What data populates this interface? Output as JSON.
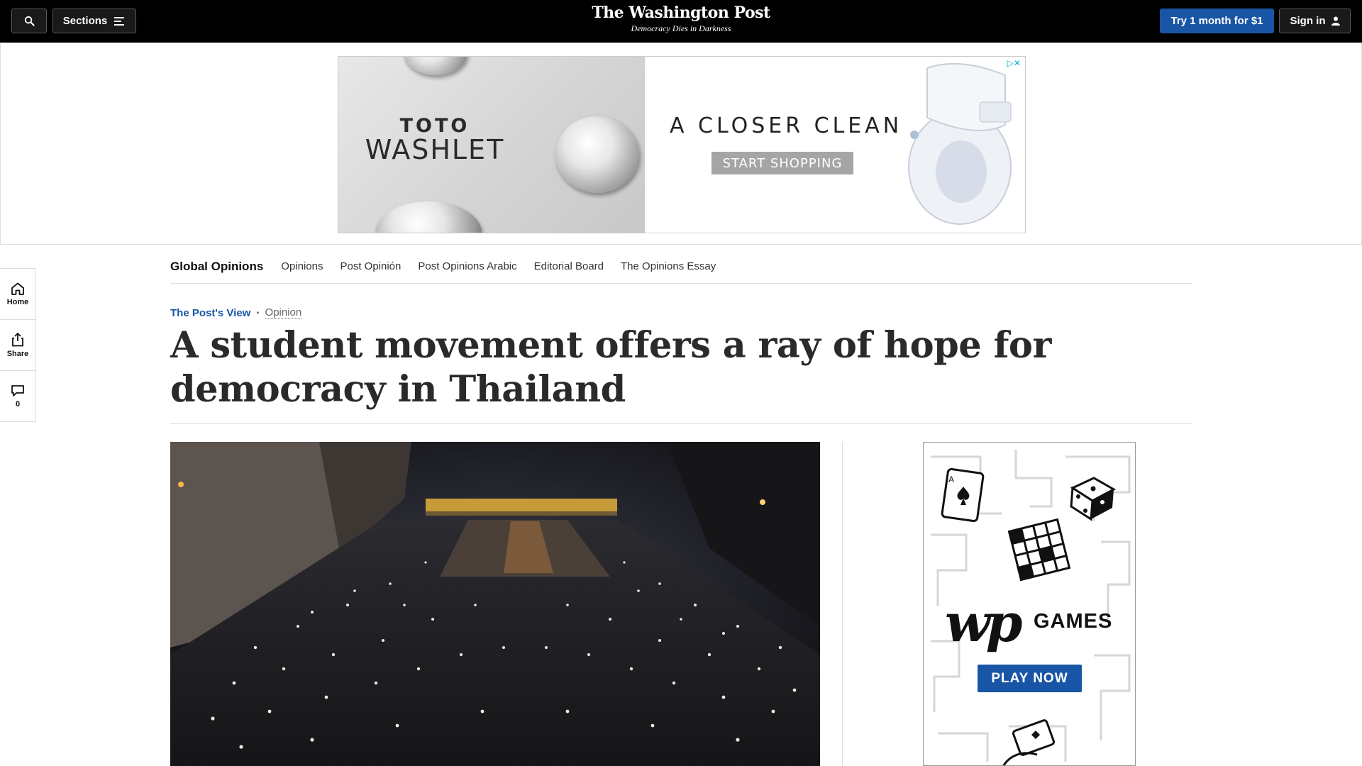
{
  "topbar": {
    "sections_label": "Sections",
    "logo": "The Washington Post",
    "tagline": "Democracy Dies in Darkness",
    "try_label": "Try 1 month for $1",
    "signin_label": "Sign in"
  },
  "ad": {
    "brand_top": "TOTO",
    "brand_bottom": "WASHLET",
    "headline": "A CLOSER CLEAN",
    "cta": "START SHOPPING"
  },
  "rail": {
    "home": "Home",
    "share": "Share",
    "comments_count": "0"
  },
  "subnav": {
    "title": "Global Opinions",
    "items": [
      "Opinions",
      "Post Opinión",
      "Post Opinions Arabic",
      "Editorial Board",
      "The Opinions Essay"
    ]
  },
  "article": {
    "kicker": "The Post's View",
    "section": "Opinion",
    "headline": "A student movement offers a ray of hope for democracy in Thailand"
  },
  "games_ad": {
    "logo": "wp",
    "word": "GAMES",
    "cta": "PLAY NOW"
  },
  "colors": {
    "topbar": "#000000",
    "accent_blue": "#1955a5",
    "headline": "#2a2a2a"
  }
}
